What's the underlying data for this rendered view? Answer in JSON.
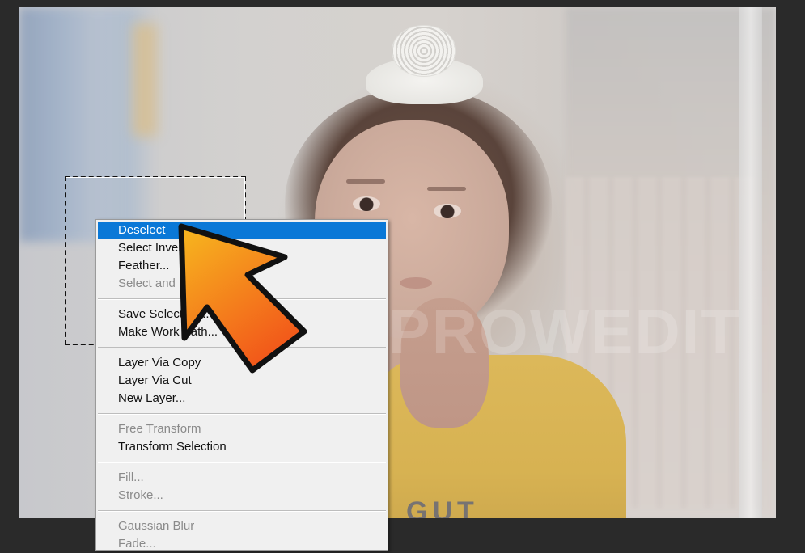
{
  "canvas": {
    "watermark_text": "CLIPPROWEDIT",
    "shirt_text": "GUT"
  },
  "context_menu": {
    "groups": [
      [
        {
          "label": "Deselect",
          "state": "highlighted"
        },
        {
          "label": "Select Inverse",
          "state": "enabled"
        },
        {
          "label": "Feather...",
          "state": "enabled"
        },
        {
          "label": "Select and Mask...",
          "state": "disabled"
        }
      ],
      [
        {
          "label": "Save Selection...",
          "state": "enabled"
        },
        {
          "label": "Make Work Path...",
          "state": "enabled"
        }
      ],
      [
        {
          "label": "Layer Via Copy",
          "state": "enabled"
        },
        {
          "label": "Layer Via Cut",
          "state": "enabled"
        },
        {
          "label": "New Layer...",
          "state": "enabled"
        }
      ],
      [
        {
          "label": "Free Transform",
          "state": "disabled"
        },
        {
          "label": "Transform Selection",
          "state": "enabled"
        }
      ],
      [
        {
          "label": "Fill...",
          "state": "disabled"
        },
        {
          "label": "Stroke...",
          "state": "disabled"
        }
      ],
      [
        {
          "label": "Gaussian Blur",
          "state": "disabled"
        },
        {
          "label": "Fade...",
          "state": "disabled"
        }
      ]
    ]
  },
  "colors": {
    "highlight": "#0a78d7",
    "arrow_top": "#f7b81f",
    "arrow_bottom": "#f2561a"
  },
  "icons": {
    "pointer": "arrow-pointer-icon"
  }
}
